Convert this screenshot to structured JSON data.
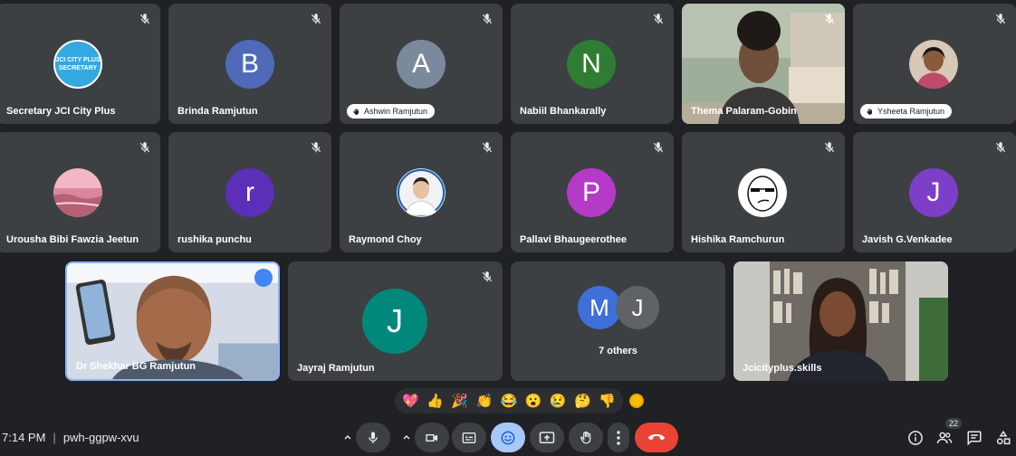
{
  "participants": [
    {
      "name": "Secretary JCI City Plus",
      "avatar_type": "logo",
      "avatar_text_1": "JCI CITY PLUS",
      "avatar_text_2": "SECRETARY",
      "color": "#35a8e0"
    },
    {
      "name": "Brinda Ramjutun",
      "avatar_letter": "B",
      "color": "#4e6ab8"
    },
    {
      "name": "Ashwin Ramjutun",
      "avatar_letter": "A",
      "color": "#7a8a9c",
      "hand_raised_pill": true
    },
    {
      "name": "Nabiil Bhankarally",
      "avatar_letter": "N",
      "color": "#2e7d32"
    },
    {
      "name": "Thema Palaram-Gobin",
      "avatar_type": "video"
    },
    {
      "name": "Ysheeta Ramjutun",
      "avatar_type": "photo",
      "hand_raised_pill": true
    },
    {
      "name": "Urousha Bibi Fawzia Jeetun",
      "avatar_type": "photo-landscape"
    },
    {
      "name": "rushika punchu",
      "avatar_letter": "r",
      "color": "#5b2fb8"
    },
    {
      "name": "Raymond Choy",
      "avatar_type": "photo-portrait"
    },
    {
      "name": "Pallavi Bhaugeerothee",
      "avatar_letter": "P",
      "color": "#b53ac7"
    },
    {
      "name": "Hishika Ramchurun",
      "avatar_type": "cartoon"
    },
    {
      "name": "Javish G.Venkadee",
      "avatar_letter": "J",
      "color": "#7e3fc8"
    },
    {
      "name": "Dr Shekhar BG Ramjutun",
      "avatar_type": "video-presenting"
    },
    {
      "name": "Jayraj Ramjutun",
      "avatar_letter": "J",
      "color": "#00897b"
    },
    {
      "name": "7 others",
      "avatar_letters": [
        "M",
        "J"
      ],
      "colors": [
        "#3f6fd8",
        "#5f6368"
      ]
    },
    {
      "name": "Jcicityplus.skills",
      "avatar_type": "video"
    }
  ],
  "reactions": [
    "💖",
    "👍",
    "🎉",
    "👏",
    "😂",
    "😮",
    "😢",
    "🤔",
    "👎"
  ],
  "meeting": {
    "time": "7:14 PM",
    "code": "pwh-ggpw-xvu"
  },
  "people_count": "22",
  "colors": {
    "background": "#202124",
    "tile": "#3c4043",
    "end_call": "#ea4335",
    "active_control": "#a8c7fa"
  }
}
